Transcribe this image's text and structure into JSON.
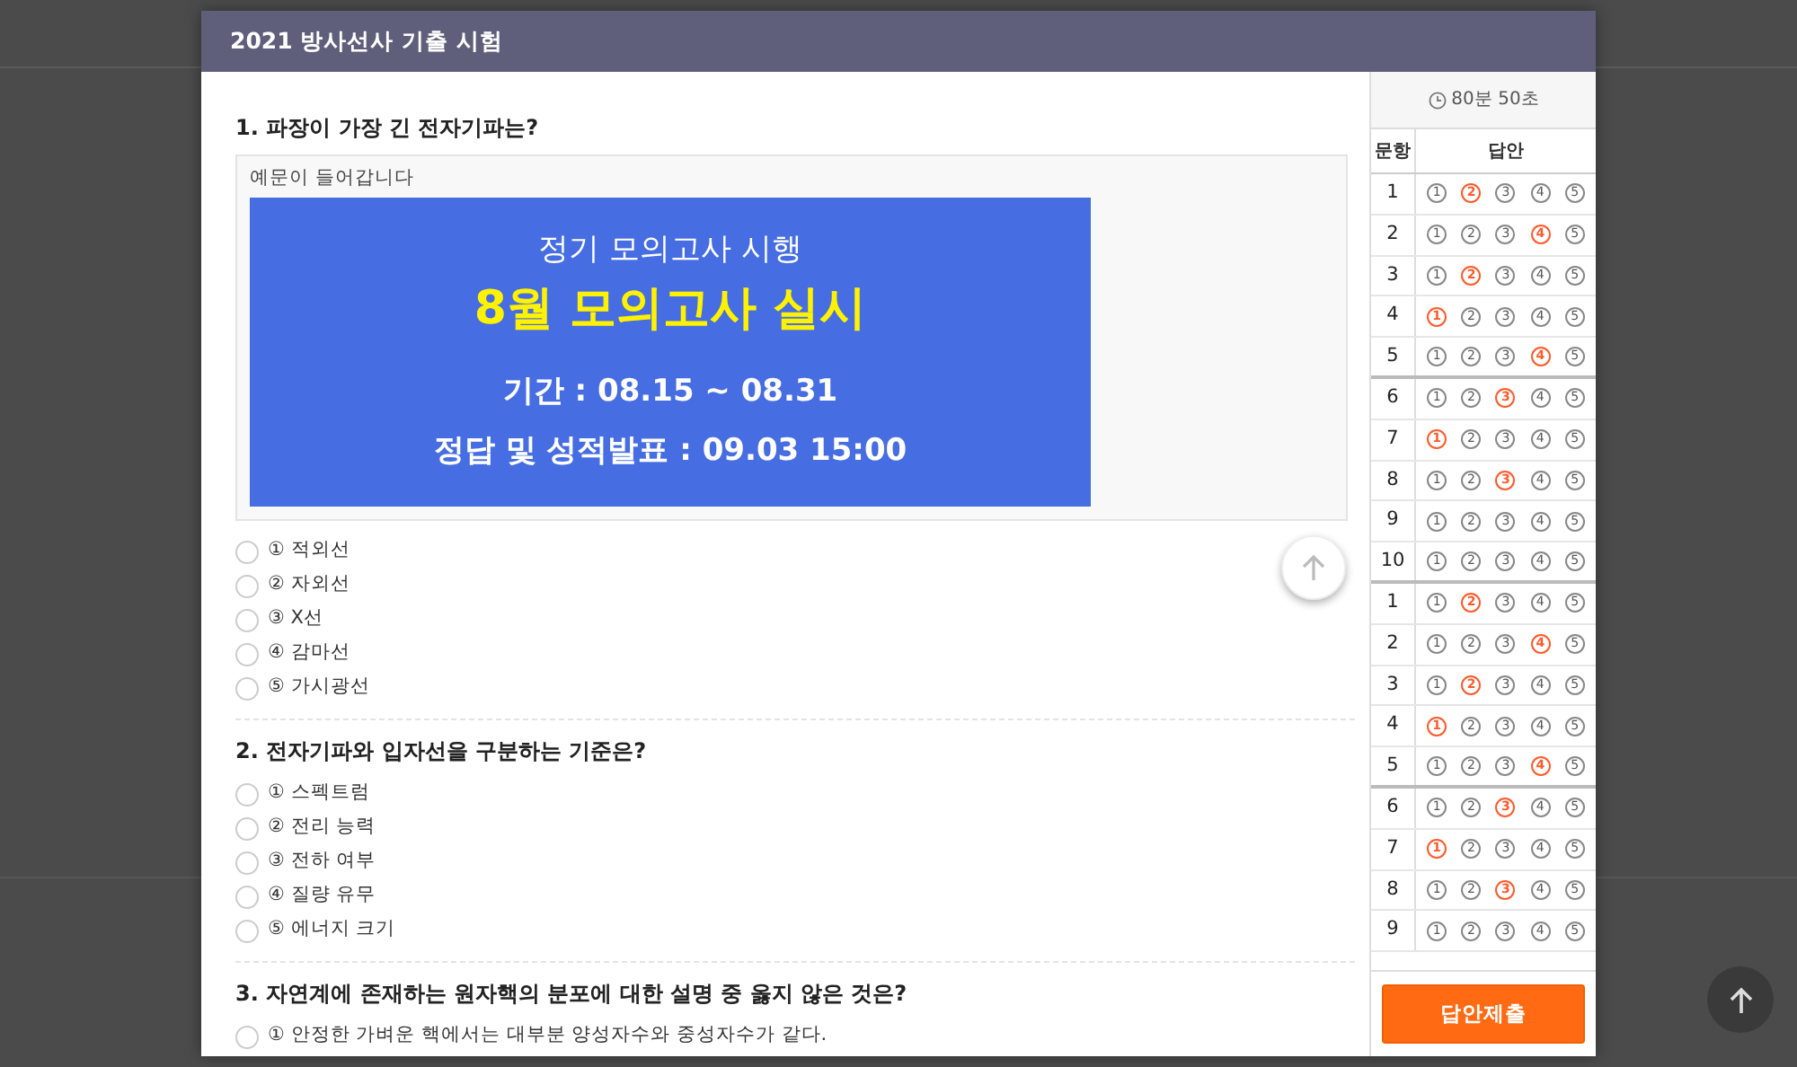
{
  "window": {
    "title": "2021 방사선사 기출 시험"
  },
  "questions": [
    {
      "title": "1. 파장이 가장 긴 전자기파는?",
      "passage": {
        "caption": "예문이 들어갑니다",
        "banner": {
          "subtitle": "정기 모의고사 시행",
          "headline": "8월 모의고사 실시",
          "period": "기간 : 08.15 ~ 08.31",
          "result": "정답 및 성적발표 : 09.03 15:00"
        }
      },
      "options": [
        {
          "label": "① 적외선",
          "selected": false
        },
        {
          "label": "② 자외선",
          "selected": false
        },
        {
          "label": "③ X선",
          "selected": false
        },
        {
          "label": "④ 감마선",
          "selected": false
        },
        {
          "label": "⑤ 가시광선",
          "selected": false
        }
      ]
    },
    {
      "title": "2. 전자기파와 입자선을 구분하는 기준은?",
      "options": [
        {
          "label": "① 스펙트럼",
          "selected": false
        },
        {
          "label": "② 전리 능력",
          "selected": false
        },
        {
          "label": "③ 전하 여부",
          "selected": false
        },
        {
          "label": "④ 질량 유무",
          "selected": false
        },
        {
          "label": "⑤ 에너지 크기",
          "selected": false
        }
      ]
    },
    {
      "title": "3. 자연계에 존재하는 원자핵의 분포에 대한 설명 중 옳지 않은 것은?",
      "options": [
        {
          "label": "① 안정한 가벼운 핵에서는 대부분 양성자수와 중성자수가 같다.",
          "selected": false
        }
      ]
    }
  ],
  "answer_sheet": {
    "timer": "80분 50초",
    "columns": [
      "문항",
      "답안"
    ],
    "rows": [
      {
        "number": "1",
        "choices": [
          {
            "label": "1",
            "selected": false
          },
          {
            "label": "2",
            "selected": true
          },
          {
            "label": "3",
            "selected": false
          },
          {
            "label": "4",
            "selected": false
          },
          {
            "label": "5",
            "selected": false
          }
        ]
      },
      {
        "number": "2",
        "choices": [
          {
            "label": "1",
            "selected": false
          },
          {
            "label": "2",
            "selected": false
          },
          {
            "label": "3",
            "selected": false
          },
          {
            "label": "4",
            "selected": true
          },
          {
            "label": "5",
            "selected": false
          }
        ]
      },
      {
        "number": "3",
        "choices": [
          {
            "label": "1",
            "selected": false
          },
          {
            "label": "2",
            "selected": true
          },
          {
            "label": "3",
            "selected": false
          },
          {
            "label": "4",
            "selected": false
          },
          {
            "label": "5",
            "selected": false
          }
        ]
      },
      {
        "number": "4",
        "choices": [
          {
            "label": "1",
            "selected": true
          },
          {
            "label": "2",
            "selected": false
          },
          {
            "label": "3",
            "selected": false
          },
          {
            "label": "4",
            "selected": false
          },
          {
            "label": "5",
            "selected": false
          }
        ]
      },
      {
        "number": "5",
        "choices": [
          {
            "label": "1",
            "selected": false
          },
          {
            "label": "2",
            "selected": false
          },
          {
            "label": "3",
            "selected": false
          },
          {
            "label": "4",
            "selected": true
          },
          {
            "label": "5",
            "selected": false
          }
        ]
      },
      {
        "number": "6",
        "choices": [
          {
            "label": "1",
            "selected": false
          },
          {
            "label": "2",
            "selected": false
          },
          {
            "label": "3",
            "selected": true
          },
          {
            "label": "4",
            "selected": false
          },
          {
            "label": "5",
            "selected": false
          }
        ]
      },
      {
        "number": "7",
        "choices": [
          {
            "label": "1",
            "selected": true
          },
          {
            "label": "2",
            "selected": false
          },
          {
            "label": "3",
            "selected": false
          },
          {
            "label": "4",
            "selected": false
          },
          {
            "label": "5",
            "selected": false
          }
        ]
      },
      {
        "number": "8",
        "choices": [
          {
            "label": "1",
            "selected": false
          },
          {
            "label": "2",
            "selected": false
          },
          {
            "label": "3",
            "selected": true
          },
          {
            "label": "4",
            "selected": false
          },
          {
            "label": "5",
            "selected": false
          }
        ]
      },
      {
        "number": "9",
        "choices": [
          {
            "label": "1",
            "selected": false
          },
          {
            "label": "2",
            "selected": false
          },
          {
            "label": "3",
            "selected": false
          },
          {
            "label": "4",
            "selected": false
          },
          {
            "label": "5",
            "selected": false
          }
        ]
      },
      {
        "number": "10",
        "choices": [
          {
            "label": "1",
            "selected": false
          },
          {
            "label": "2",
            "selected": false
          },
          {
            "label": "3",
            "selected": false
          },
          {
            "label": "4",
            "selected": false
          },
          {
            "label": "5",
            "selected": false
          }
        ]
      },
      {
        "number": "1",
        "choices": [
          {
            "label": "1",
            "selected": false
          },
          {
            "label": "2",
            "selected": true
          },
          {
            "label": "3",
            "selected": false
          },
          {
            "label": "4",
            "selected": false
          },
          {
            "label": "5",
            "selected": false
          }
        ]
      },
      {
        "number": "2",
        "choices": [
          {
            "label": "1",
            "selected": false
          },
          {
            "label": "2",
            "selected": false
          },
          {
            "label": "3",
            "selected": false
          },
          {
            "label": "4",
            "selected": true
          },
          {
            "label": "5",
            "selected": false
          }
        ]
      },
      {
        "number": "3",
        "choices": [
          {
            "label": "1",
            "selected": false
          },
          {
            "label": "2",
            "selected": true
          },
          {
            "label": "3",
            "selected": false
          },
          {
            "label": "4",
            "selected": false
          },
          {
            "label": "5",
            "selected": false
          }
        ]
      },
      {
        "number": "4",
        "choices": [
          {
            "label": "1",
            "selected": true
          },
          {
            "label": "2",
            "selected": false
          },
          {
            "label": "3",
            "selected": false
          },
          {
            "label": "4",
            "selected": false
          },
          {
            "label": "5",
            "selected": false
          }
        ]
      },
      {
        "number": "5",
        "choices": [
          {
            "label": "1",
            "selected": false
          },
          {
            "label": "2",
            "selected": false
          },
          {
            "label": "3",
            "selected": false
          },
          {
            "label": "4",
            "selected": true
          },
          {
            "label": "5",
            "selected": false
          }
        ]
      },
      {
        "number": "6",
        "choices": [
          {
            "label": "1",
            "selected": false
          },
          {
            "label": "2",
            "selected": false
          },
          {
            "label": "3",
            "selected": true
          },
          {
            "label": "4",
            "selected": false
          },
          {
            "label": "5",
            "selected": false
          }
        ]
      },
      {
        "number": "7",
        "choices": [
          {
            "label": "1",
            "selected": true
          },
          {
            "label": "2",
            "selected": false
          },
          {
            "label": "3",
            "selected": false
          },
          {
            "label": "4",
            "selected": false
          },
          {
            "label": "5",
            "selected": false
          }
        ]
      },
      {
        "number": "8",
        "choices": [
          {
            "label": "1",
            "selected": false
          },
          {
            "label": "2",
            "selected": false
          },
          {
            "label": "3",
            "selected": true
          },
          {
            "label": "4",
            "selected": false
          },
          {
            "label": "5",
            "selected": false
          }
        ]
      },
      {
        "number": "9",
        "choices": [
          {
            "label": "1",
            "selected": false
          },
          {
            "label": "2",
            "selected": false
          },
          {
            "label": "3",
            "selected": false
          },
          {
            "label": "4",
            "selected": false
          },
          {
            "label": "5",
            "selected": false
          }
        ]
      }
    ],
    "submit": "답안제출"
  }
}
